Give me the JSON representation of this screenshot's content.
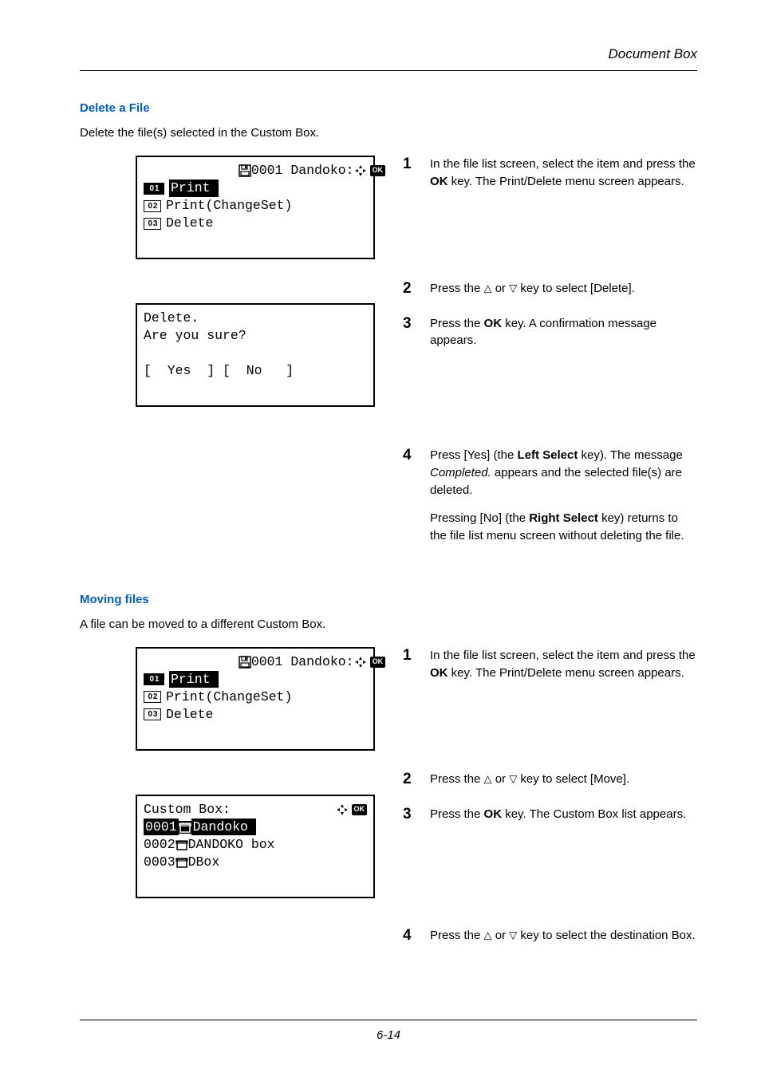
{
  "header_section": "Document Box",
  "section1": {
    "heading": "Delete a File",
    "intro": "Delete the file(s) selected in the Custom Box.",
    "lcd1": {
      "title_prefix": "0001 Dandoko:",
      "row1": {
        "num": "0 1",
        "label": "Print"
      },
      "row2": {
        "num": "0 2",
        "label": "Print(ChangeSet)"
      },
      "row3": {
        "num": "0 3",
        "label": "Delete"
      }
    },
    "lcd2": {
      "line1": "Delete.",
      "line2": "Are you sure?",
      "line3": "[  Yes  ] [  No   ]"
    },
    "steps": {
      "s1": {
        "n": "1",
        "text_a": "In the file list screen, select the item and press the ",
        "text_b": " key. The Print/Delete menu screen appears.",
        "key": "OK"
      },
      "s2": {
        "n": "2",
        "text_a": "Press the ",
        "text_b": " or ",
        "text_c": " key to select [Delete]."
      },
      "s3": {
        "n": "3",
        "text_a": "Press the ",
        "text_b": " key. A confirmation message appears.",
        "key": "OK"
      },
      "s4": {
        "n": "4",
        "p1_a": "Press [Yes] (the ",
        "p1_key": "Left Select",
        "p1_b": " key). The message ",
        "p1_i": "Completed.",
        "p1_c": " appears and the selected file(s) are deleted.",
        "p2_a": "Pressing [No] (the ",
        "p2_key": "Right Select",
        "p2_b": " key) returns to the file list menu screen without deleting the file."
      }
    }
  },
  "section2": {
    "heading": "Moving files",
    "intro": "A file can be moved to a different Custom Box.",
    "lcd1": {
      "title_prefix": "0001 Dandoko:",
      "row1": {
        "num": "0 1",
        "label": "Print"
      },
      "row2": {
        "num": "0 2",
        "label": "Print(ChangeSet)"
      },
      "row3": {
        "num": "0 3",
        "label": "Delete"
      }
    },
    "lcd2": {
      "title": "Custom Box:",
      "row1": {
        "id": "0001",
        "name": "Dandoko"
      },
      "row2": {
        "id": "0002",
        "name": "DANDOKO box"
      },
      "row3": {
        "id": "0003",
        "name": "DBox"
      }
    },
    "steps": {
      "s1": {
        "n": "1",
        "text_a": "In the file list screen, select the item and press the ",
        "text_b": " key. The Print/Delete menu screen appears.",
        "key": "OK"
      },
      "s2": {
        "n": "2",
        "text_a": "Press the ",
        "text_b": " or ",
        "text_c": " key to select [Move]."
      },
      "s3": {
        "n": "3",
        "text_a": "Press the ",
        "text_b": " key. The Custom Box list appears.",
        "key": "OK"
      },
      "s4": {
        "n": "4",
        "text_a": "Press the ",
        "text_b": " or ",
        "text_c": " key to select the destination Box."
      }
    }
  },
  "footer_page": "6-14"
}
